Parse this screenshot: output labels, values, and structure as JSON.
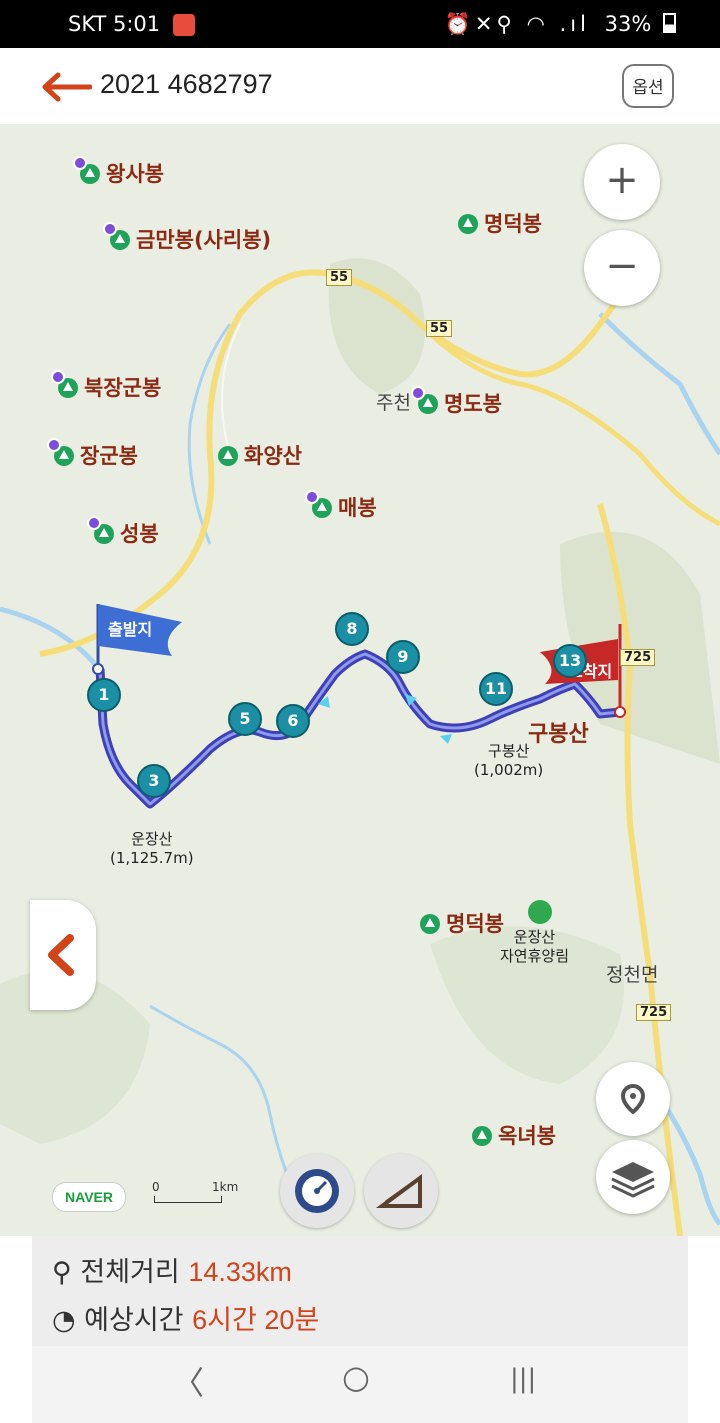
{
  "status_bar": {
    "carrier_time": "SKT 5:01",
    "battery": "33%",
    "icons": "⏰✕⚲ ◠ .ıl"
  },
  "header": {
    "title": "2021 4682797",
    "option_label": "옵션"
  },
  "map": {
    "peaks": {
      "wangsabong": "왕사봉",
      "geummanbong": "금만봉(사리봉)",
      "myeongdeokbong_top": "명덕봉",
      "bukjanggunbong": "북장군봉",
      "myeongdobong": "명도봉",
      "jugunbong": "장군봉",
      "hwayangsan": "화양산",
      "maebong": "매봉",
      "seongbong": "성봉",
      "gubongsan_big": "구봉산",
      "myeongdeokbong_bottom": "명덕봉",
      "oknyeobong": "옥녀봉"
    },
    "jucheon": "주천",
    "unjangsan": {
      "name": "운장산",
      "elev": "(1,125.7m)"
    },
    "gubongsan": {
      "name": "구봉산",
      "elev": "(1,002m)"
    },
    "forest": {
      "line1": "운장산",
      "line2": "자연휴양림"
    },
    "jeongcheon": "정천면",
    "roads": {
      "r55a": "55",
      "r55b": "55",
      "r725a": "725",
      "r725b": "725"
    },
    "start_flag": "출발지",
    "end_flag": "도착지",
    "waypoints": [
      "1",
      "3",
      "5",
      "6",
      "8",
      "9",
      "11",
      "13"
    ],
    "zoom_in": "+",
    "zoom_out": "−",
    "naver": "NAVER",
    "scale_zero": "0",
    "scale_label": "1km"
  },
  "info": {
    "distance_label": "전체거리",
    "distance_value": "14.33km",
    "time_label": "예상시간",
    "time_value": "6시간 20분"
  },
  "navbar": {
    "back": "〈",
    "home": "○",
    "recents": "|||"
  },
  "colors": {
    "accent": "#d2431a",
    "route": "#4a4fc9",
    "marker": "#1b8fa3"
  }
}
